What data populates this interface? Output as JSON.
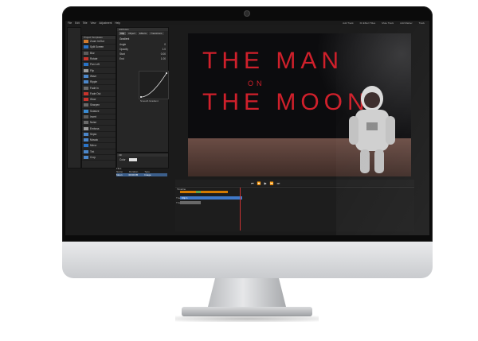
{
  "menubar": [
    "File",
    "Edit",
    "Title",
    "View",
    "Adjustment",
    "Help"
  ],
  "topbar": [
    "Add Track",
    "Fit Effect Titles",
    "Mute Track",
    "Add Marker",
    "Track"
  ],
  "project": {
    "panel_title": "Project Templates",
    "items": [
      {
        "label": "Zoom In/Out",
        "color": "#d17b2d"
      },
      {
        "label": "Split Screen",
        "color": "#2a73c7"
      },
      {
        "label": "Blur",
        "color": "#5c5c5c"
      },
      {
        "label": "Rotate",
        "color": "#c7342c"
      },
      {
        "label": "Pan Left",
        "color": "#2a73c7"
      },
      {
        "label": "Flip",
        "color": "#9c9c9c"
      },
      {
        "label": "Wave",
        "color": "#4b86c9"
      },
      {
        "label": "Ripple",
        "color": "#4b86c9"
      },
      {
        "label": "Fade In",
        "color": "#6a6a6a"
      },
      {
        "label": "Fade Out",
        "color": "#c7342c"
      },
      {
        "label": "Glow",
        "color": "#c7342c"
      },
      {
        "label": "Sharpen",
        "color": "#6a6a6a"
      },
      {
        "label": "Solarize",
        "color": "#3a8bd3"
      },
      {
        "label": "Invert",
        "color": "#5c5c5c"
      },
      {
        "label": "Noise",
        "color": "#6a6a6a"
      },
      {
        "label": "Emboss",
        "color": "#9c9c9c"
      },
      {
        "label": "Sepia",
        "color": "#4b86c9"
      },
      {
        "label": "Mosaic",
        "color": "#4b86c9"
      },
      {
        "label": "Mirror",
        "color": "#2a73c7"
      },
      {
        "label": "Tint",
        "color": "#4b86c9"
      },
      {
        "label": "Crop",
        "color": "#4b86c9"
      }
    ]
  },
  "properties": {
    "panel_title": "Attributes",
    "tabs": [
      "Clip",
      "Object",
      "Effects",
      "Transitions"
    ],
    "section_title": "Gradient",
    "fields": [
      {
        "label": "Angle",
        "value": "0"
      },
      {
        "label": "Opacity",
        "value": "1.0"
      },
      {
        "label": "Start",
        "value": "0.00"
      },
      {
        "label": "End",
        "value": "1.00"
      }
    ],
    "checkbox": "Smooth Gradient",
    "fill_title": "Fill",
    "fill_label": "Color"
  },
  "files": {
    "title": "Files",
    "columns": [
      "Name",
      "Duration",
      "Type"
    ],
    "row": [
      "Moon",
      "00:00:05",
      "Image"
    ]
  },
  "title_card": {
    "line1": "THE MAN",
    "line2": "ON",
    "line3": "THE MOON"
  },
  "timeline": {
    "title": "Timeline",
    "tracks": [
      "Track 1",
      "Track 2"
    ],
    "clip": "Clip 1"
  },
  "colors": {
    "title_red": "#d0202b",
    "timeline_orange": "#d47a00",
    "track_blue": "#3f79c9"
  }
}
